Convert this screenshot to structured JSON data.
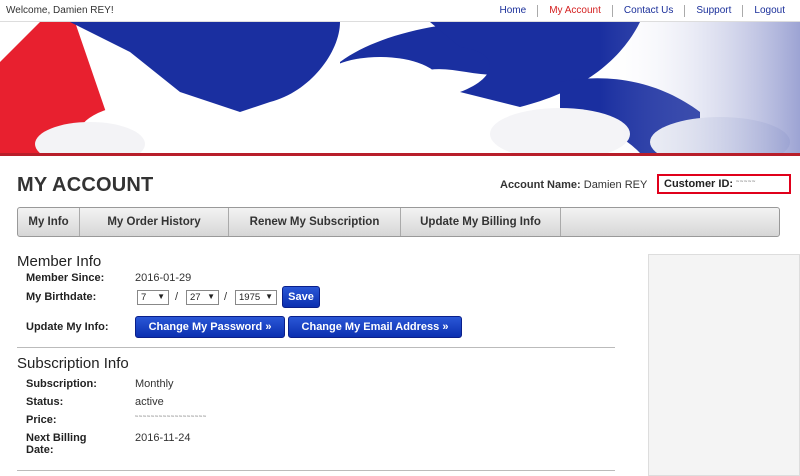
{
  "topbar": {
    "welcome": "Welcome, Damien REY!",
    "nav": [
      "Home",
      "My Account",
      "Contact Us",
      "Support",
      "Logout"
    ],
    "active_color": "#d42020"
  },
  "page": {
    "title": "MY ACCOUNT",
    "account_name_label": "Account Name:",
    "account_name": "Damien REY",
    "customer_id_label": "Customer ID:",
    "customer_id_masked": "˜˜˜˜˜"
  },
  "tabs": [
    "My Info",
    "My Order History",
    "Renew My Subscription",
    "Update My Billing Info"
  ],
  "member_info": {
    "heading": "Member Info",
    "member_since_label": "Member Since:",
    "member_since": "2016-01-29",
    "birthdate_label": "My Birthdate:",
    "birth_month": "7",
    "birth_day": "27",
    "birth_year": "1975",
    "save_label": "Save",
    "update_label": "Update My Info:",
    "change_password_label": "Change My Password »",
    "change_email_label": "Change My Email Address »"
  },
  "subscription_info": {
    "heading": "Subscription Info",
    "subscription_label": "Subscription:",
    "subscription": "Monthly",
    "status_label": "Status:",
    "status": "active",
    "price_label": "Price:",
    "price_masked": "˜˜˜˜˜˜˜˜˜˜˜˜˜˜˜˜˜˜",
    "next_billing_label_1": "Next Billing",
    "next_billing_label_2": "Date:",
    "next_billing": "2016-11-24"
  },
  "colors": {
    "brand_blue": "#1a2fa0",
    "brand_red": "#e8202f",
    "highlight": "#e0001b"
  }
}
